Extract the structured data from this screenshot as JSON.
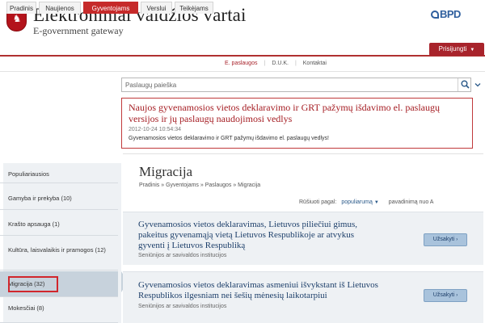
{
  "header": {
    "title": "Elektroniniai valdžios vartai",
    "subtitle": "E-government gateway",
    "partner_logo": "BPD"
  },
  "nav": {
    "tabs": [
      {
        "label": "Pradinis",
        "active": false
      },
      {
        "label": "Naujienos",
        "active": false
      },
      {
        "label": "Gyventojams",
        "active": true
      },
      {
        "label": "Verslui",
        "active": false
      },
      {
        "label": "Teikėjams",
        "active": false
      }
    ],
    "login_label": "Prisijungti"
  },
  "subnav": {
    "items": [
      "E. paslaugos",
      "D.U.K.",
      "Kontaktai"
    ]
  },
  "search": {
    "placeholder": "Paslaugų paieška"
  },
  "news": {
    "title": "Naujos gyvenamosios vietos deklaravimo ir GRT pažymų išdavimo el. paslaugų versijos ir jų paslaugų naudojimosi vedlys",
    "date": "2012-10-24 10:54:34",
    "text": "Gyvenamosios vietos deklaravimo ir GRT pažymų išdavimo el. paslaugų vedlys!"
  },
  "sidebar": {
    "items": [
      {
        "label": "Populiariausios"
      },
      {
        "label": "Gamyba ir prekyba (10)"
      },
      {
        "label": "Krašto apsauga (1)"
      },
      {
        "label": "Kultūra, laisvalaikis ir pramogos (12)"
      },
      {
        "label": "Migracija (32)",
        "active": true
      },
      {
        "label": "Mokesčiai (8)"
      }
    ]
  },
  "main": {
    "title": "Migracija",
    "breadcrumb": "Pradinis » Gyventojams » Paslaugos » Migracija",
    "sort_label": "Rūšiuoti pagal:",
    "sort_selected": "populiarumą",
    "sort_alt": "pavadinimą nuo A",
    "services": [
      {
        "title": "Gyvenamosios vietos deklaravimas, Lietuvos piliečiui gimus, pakeitus gyvenamąją vietą Lietuvos Respublikoje ar atvykus gyventi į Lietuvos Respubliką",
        "provider": "Seniūnijos ar savivaldos institucijos",
        "button": "Užsakyti"
      },
      {
        "title": "Gyvenamosios vietos deklaravimas asmeniui išvykstant iš Lietuvos Respublikos ilgesniam nei šešių mėnesių laikotarpiui",
        "provider": "Seniūnijos ar savivaldos institucijos",
        "button": "Užsakyti"
      }
    ]
  },
  "colors": {
    "accent_red": "#c62a2a",
    "link_blue": "#1d3f6a",
    "sidebar_bg": "#eef1f4"
  }
}
